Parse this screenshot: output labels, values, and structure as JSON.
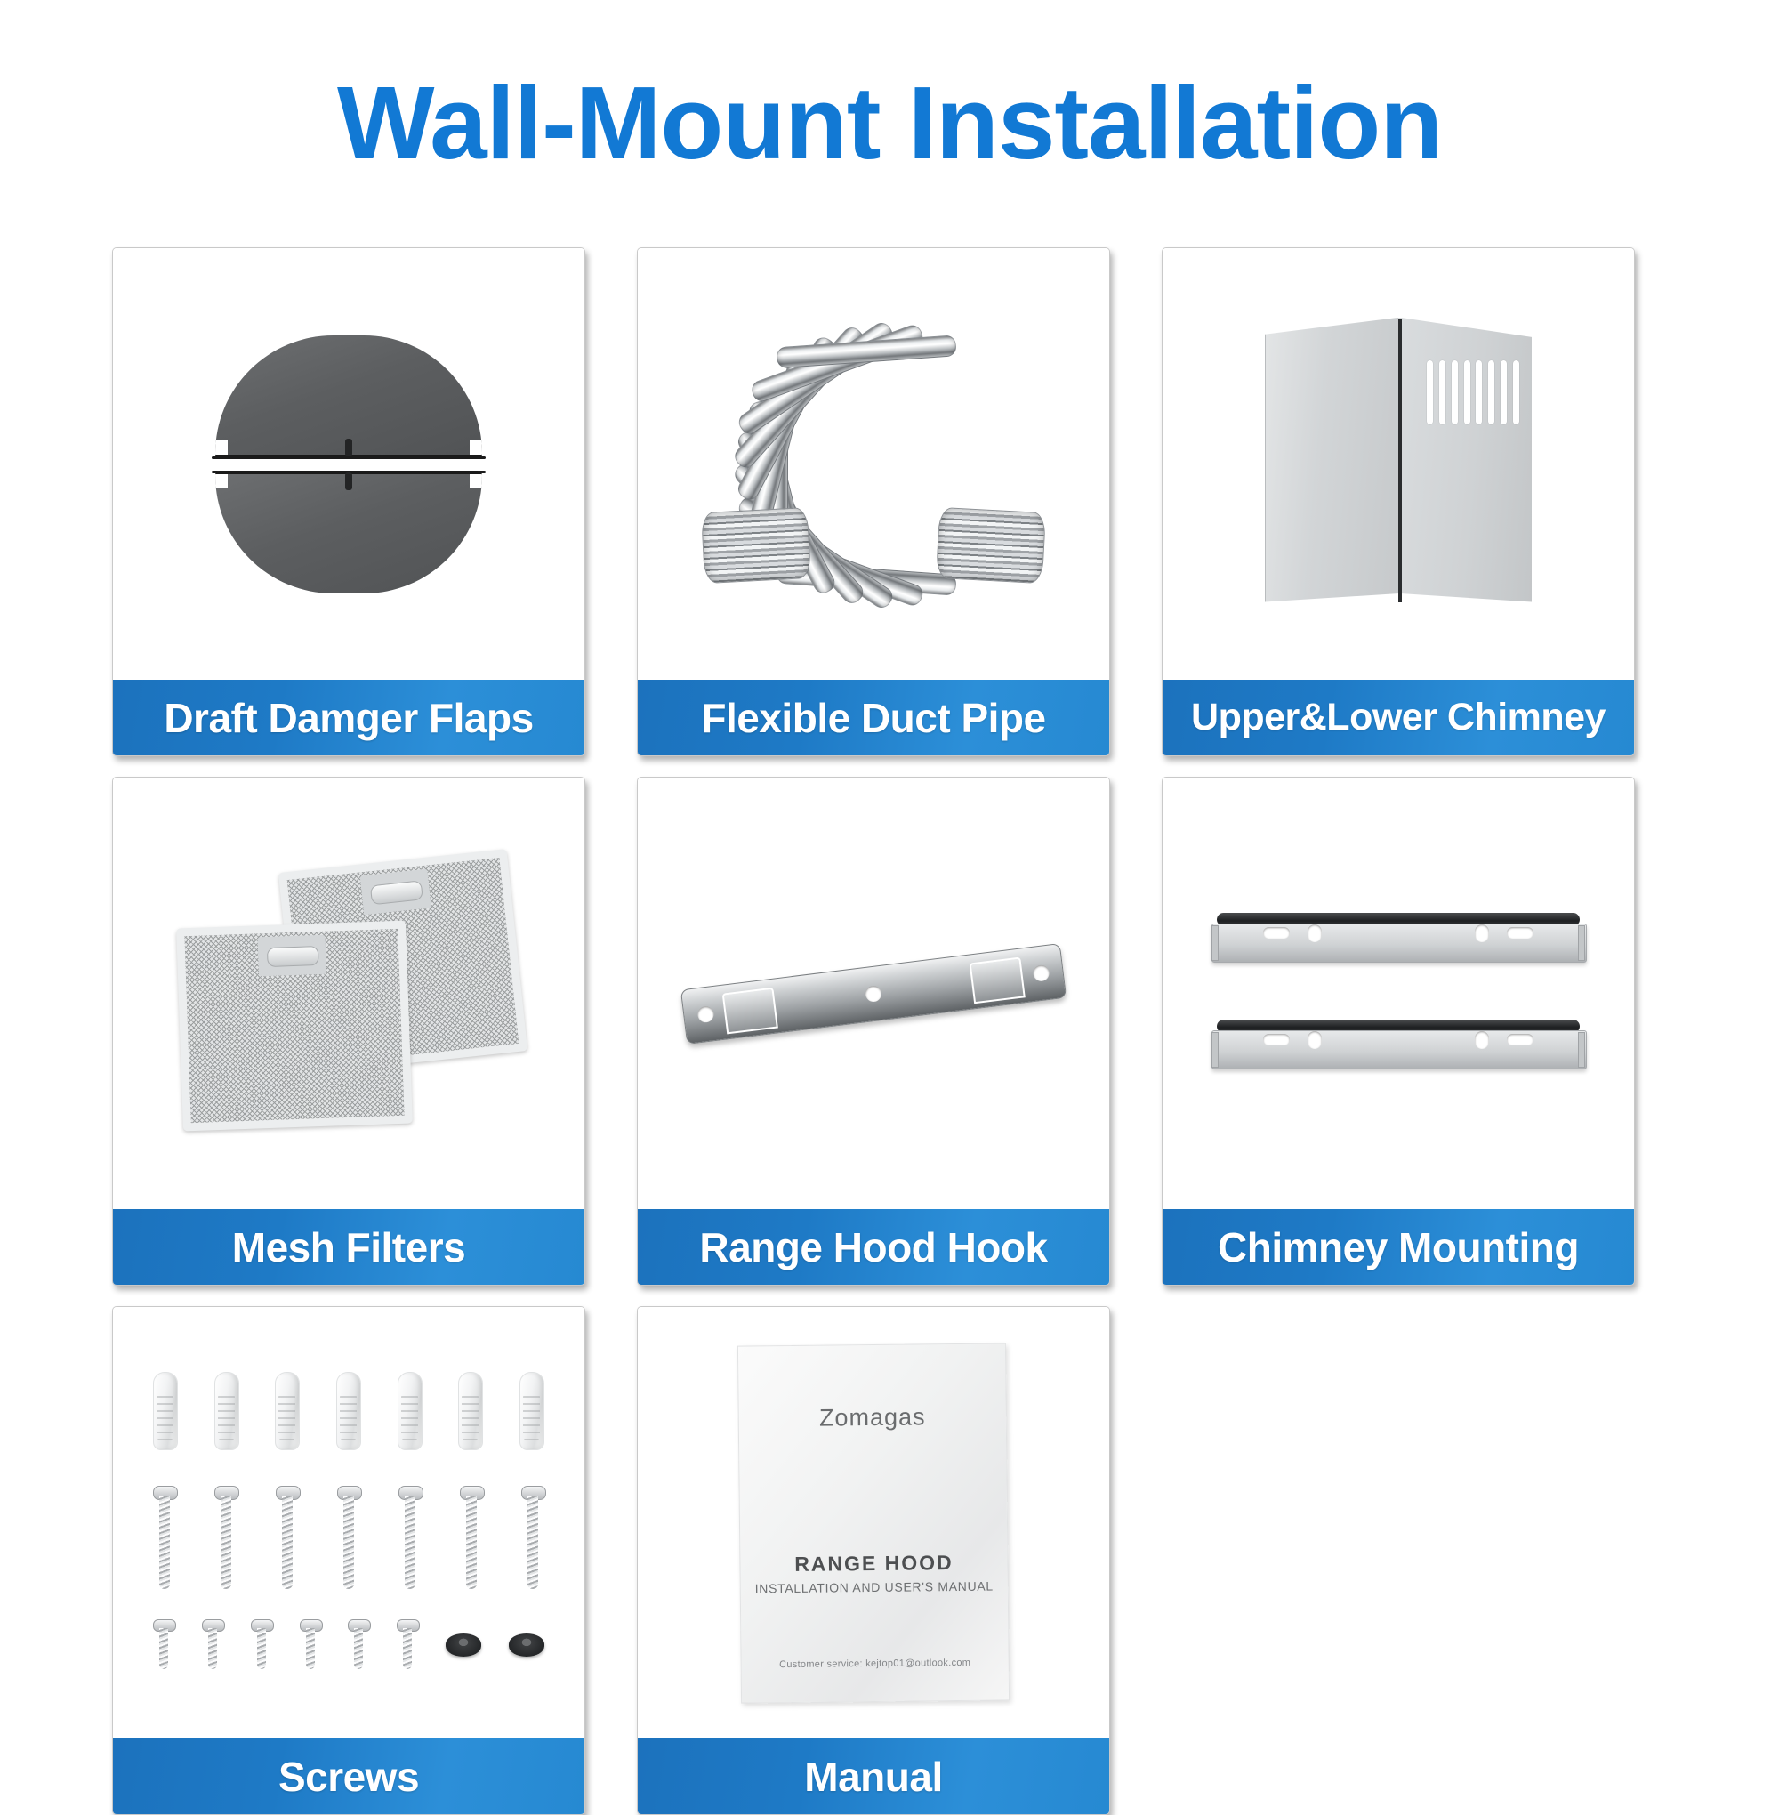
{
  "header": {
    "title": "Wall-Mount Installation",
    "title_color": "#1279D4"
  },
  "theme": {
    "label_blue_dark": "#1C72BD",
    "label_blue_light": "#2C8FD8",
    "card_border": "#C9C9C9",
    "background": "#FFFFFF",
    "label_text": "#FFFFFF"
  },
  "cards": [
    {
      "label": "Draft Damger Flaps",
      "icon": "draft-damper-flaps-image"
    },
    {
      "label": "Flexible Duct Pipe",
      "icon": "flexible-duct-pipe-image"
    },
    {
      "label": "Upper&Lower Chimney",
      "icon": "upper-lower-chimney-image"
    },
    {
      "label": "Mesh Filters",
      "icon": "mesh-filters-image"
    },
    {
      "label": "Range Hood Hook",
      "icon": "range-hood-hook-image"
    },
    {
      "label": "Chimney Mounting",
      "icon": "chimney-mounting-image"
    },
    {
      "label": "Screws",
      "icon": "screws-image"
    },
    {
      "label": "Manual",
      "icon": "manual-image"
    }
  ],
  "manual_cover": {
    "brand": "Zomagas",
    "product": "RANGE HOOD",
    "subtitle": "INSTALLATION AND USER'S MANUAL",
    "customer_service": "Customer service: kejtop01@outlook.com"
  },
  "parts_counts": {
    "wall_anchors": 7,
    "long_screws": 7,
    "short_screws": 6,
    "rubber_washers": 2,
    "mesh_filters": 2,
    "mounting_brackets": 2,
    "chimney_vent_slots": 8,
    "damper_flaps": 2,
    "hook_holes": 3
  }
}
